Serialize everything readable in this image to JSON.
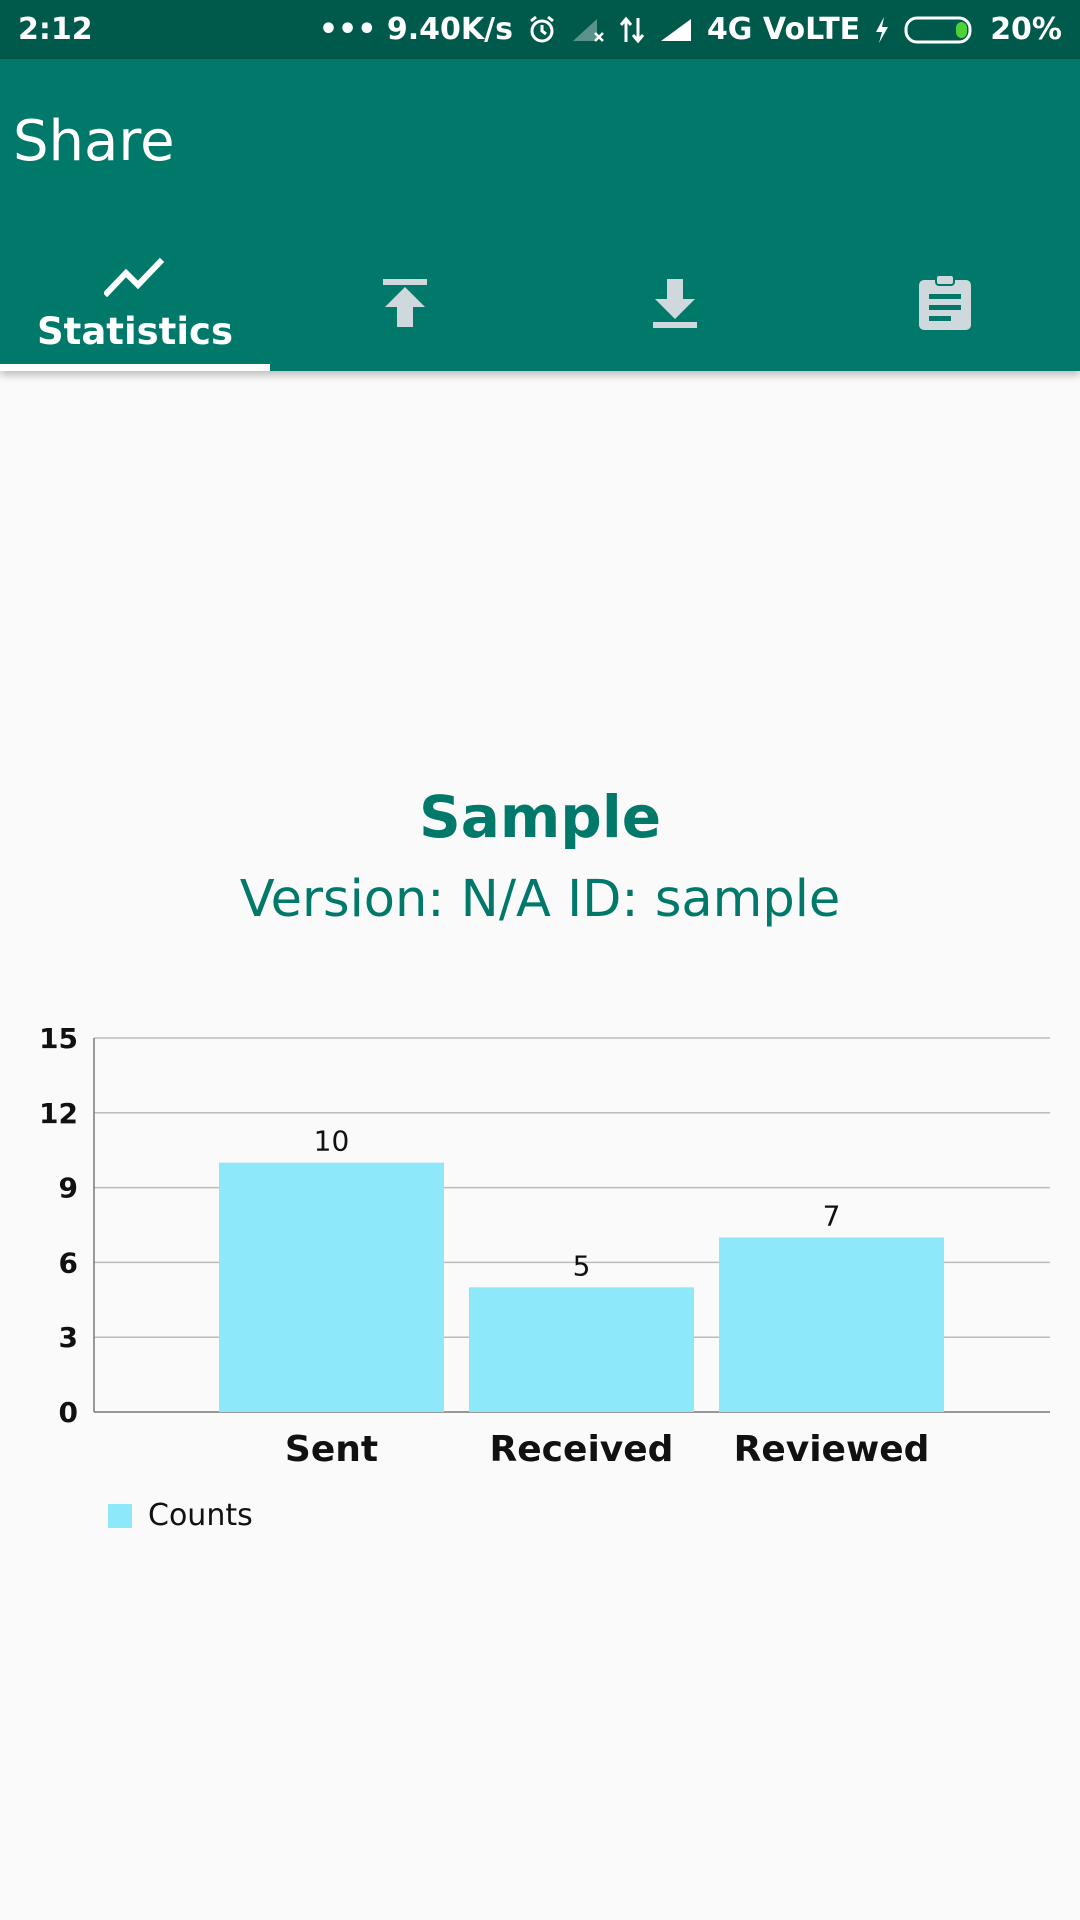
{
  "status_bar": {
    "time": "2:12",
    "network_speed": "••• 9.40K/s",
    "network_label": "4G VoLTE",
    "battery": "20%",
    "icons": [
      "alarm-icon",
      "signal-off-icon",
      "data-arrows-icon",
      "signal-icon",
      "charging-icon",
      "battery-icon"
    ]
  },
  "app_bar": {
    "title": "Share"
  },
  "tabs": [
    {
      "label": "Statistics",
      "icon": "trending-up-icon",
      "selected": true
    },
    {
      "label": "",
      "icon": "upload-icon",
      "selected": false
    },
    {
      "label": "",
      "icon": "download-icon",
      "selected": false
    },
    {
      "label": "",
      "icon": "clipboard-icon",
      "selected": false
    }
  ],
  "header": {
    "title": "Sample",
    "subtitle": "Version: N/A ID: sample"
  },
  "chart_data": {
    "type": "bar",
    "categories": [
      "Sent",
      "Received",
      "Reviewed"
    ],
    "series": [
      {
        "name": "Counts",
        "values": [
          10,
          5,
          7
        ],
        "color": "#8de8fa"
      }
    ],
    "ylim": [
      0,
      15
    ],
    "yticks": [
      "0",
      "3",
      "6",
      "9",
      "12",
      "15"
    ],
    "data_labels": [
      "10",
      "5",
      "7"
    ],
    "grid": true,
    "legend": "bottom-left"
  },
  "colors": {
    "primary": "#00796b",
    "primary_dark": "#005a4b",
    "bar": "#8de8fa",
    "background": "#fafafa"
  }
}
